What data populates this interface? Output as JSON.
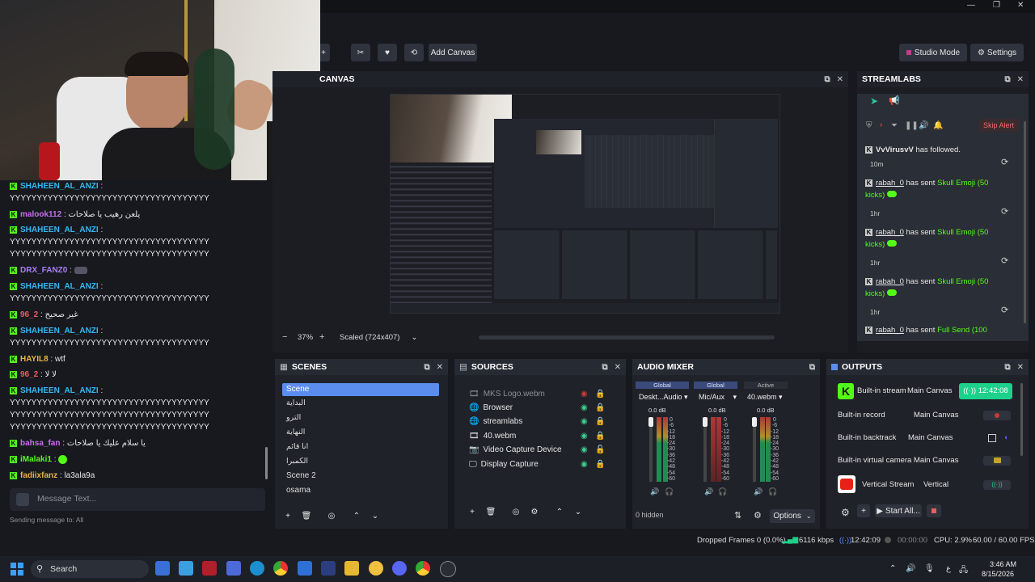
{
  "window": {
    "controls": [
      "—",
      "❐",
      "✕"
    ]
  },
  "toolbar": {
    "add_canvas_label": "Add Canvas",
    "studio_mode_label": "Studio Mode",
    "settings_label": "Settings"
  },
  "canvas": {
    "title": "CANVAS",
    "zoom": "37%",
    "scale_mode": "Scaled (724x407)",
    "minus": "−",
    "plus": "+"
  },
  "chat": {
    "messages": [
      {
        "user": "SHAHEEN_AL_ANZI",
        "color": "#35b7f3",
        "text": ":",
        "cont": "YYYYYYYYYYYYYYYYYYYYYYYYYYYYYYYYYYYYY"
      },
      {
        "user": "malook112",
        "color": "#c86ff0",
        "text": ": يلعن رهيب يا صلاحات",
        "cont": ""
      },
      {
        "user": "SHAHEEN_AL_ANZI",
        "color": "#35b7f3",
        "text": ":",
        "cont": "YYYYYYYYYYYYYYYYYYYYYYYYYYYYYYYYYYYYY",
        "cont2": "YYYYYYYYYYYYYYYYYYYYYYYYYYYYYYYYYYYYY"
      },
      {
        "user": "DRX_FANZ0",
        "color": "#a97ff5",
        "text": ":",
        "cont": ""
      },
      {
        "user": "SHAHEEN_AL_ANZI",
        "color": "#35b7f3",
        "text": ":",
        "cont": "YYYYYYYYYYYYYYYYYYYYYYYYYYYYYYYYYYYYY"
      },
      {
        "user": "96_2",
        "color": "#f05b5b",
        "text": ": غير صحيح",
        "cont": ""
      },
      {
        "user": "SHAHEEN_AL_ANZI",
        "color": "#35b7f3",
        "text": ":",
        "cont": "YYYYYYYYYYYYYYYYYYYYYYYYYYYYYYYYYYYYY"
      },
      {
        "user": "HAYIL8",
        "color": "#e7b348",
        "text": ": wtf",
        "cont": ""
      },
      {
        "user": "96_2",
        "color": "#f05b5b",
        "text": ": لا لا",
        "cont": ""
      },
      {
        "user": "SHAHEEN_AL_ANZI",
        "color": "#35b7f3",
        "text": ":",
        "cont": "YYYYYYYYYYYYYYYYYYYYYYYYYYYYYYYYYYYYY",
        "cont2": "YYYYYYYYYYYYYYYYYYYYYYYYYYYYYYYYYYYYY",
        "cont3": "YYYYYYYYYYYYYYYYYYYYYYYYYYYYYYYYYYYYY"
      },
      {
        "user": "bahsa_fan",
        "color": "#c86ff0",
        "text": ": يا سلام عليك يا صلاحات",
        "cont": ""
      },
      {
        "user": "iMalaki1",
        "color": "#53fc18",
        "text": ":",
        "cont": ""
      },
      {
        "user": "fadiixfanz",
        "color": "#e7b348",
        "text": ": la3ala9a",
        "cont": ""
      }
    ],
    "input_placeholder": "Message Text...",
    "sending_to": "Sending message to: All"
  },
  "streamlabs": {
    "title": "STREAMLABS",
    "skip_alert_label": "Skip Alert",
    "events": [
      {
        "user": "VvVirusvV",
        "action": "has followed.",
        "item": "",
        "time": "10m"
      },
      {
        "user": "rabah_0",
        "action": "has sent",
        "item": "Skull Emoji (50",
        "item2": "kicks)",
        "time": "1hr"
      },
      {
        "user": "rabah_0",
        "action": "has sent",
        "item": "Skull Emoji (50",
        "item2": "kicks)",
        "time": "1hr"
      },
      {
        "user": "rabah_0",
        "action": "has sent",
        "item": "Skull Emoji (50",
        "item2": "kicks)",
        "time": "1hr"
      },
      {
        "user": "rabah_0",
        "action": "has sent",
        "item": "Full Send (100",
        "item2": "",
        "time": ""
      }
    ]
  },
  "scenes": {
    "title": "SCENES",
    "items": [
      "Scene",
      "البداية",
      "الترو",
      "النهاية",
      "انا قائم",
      "الكمبرا",
      "Scene 2",
      "osama"
    ],
    "selected": "Scene"
  },
  "sources": {
    "title": "SOURCES",
    "items": [
      {
        "name": "MKS Logo.webm",
        "icon": "film-icon",
        "visible": false
      },
      {
        "name": "Browser",
        "icon": "globe-icon",
        "visible": true
      },
      {
        "name": "streamlabs",
        "icon": "globe-icon",
        "visible": true
      },
      {
        "name": "40.webm",
        "icon": "film-icon",
        "visible": true
      },
      {
        "name": "Video Capture Device",
        "icon": "camera-icon",
        "visible": true
      },
      {
        "name": "Display Capture",
        "icon": "monitor-icon",
        "visible": true
      }
    ]
  },
  "audio_mixer": {
    "title": "AUDIO MIXER",
    "channels": [
      {
        "group": "Global",
        "source": "Deskt...Audio",
        "db": "0.0 dB"
      },
      {
        "group": "Global",
        "source": "Mic/Aux",
        "db": "0.0 dB"
      },
      {
        "group": "Active",
        "source": "40.webm",
        "db": "0.0 dB"
      }
    ],
    "scale": [
      "0",
      "-6",
      "-12",
      "-18",
      "-24",
      "-30",
      "-36",
      "-42",
      "-48",
      "-54",
      "-60"
    ],
    "hidden_label": "0 hidden",
    "options_label": "Options"
  },
  "outputs": {
    "title": "OUTPUTS",
    "rows": [
      {
        "name": "Built-in stream",
        "canvas": "Main Canvas",
        "status": "12:42:08"
      },
      {
        "name": "Built-in record",
        "canvas": "Main Canvas",
        "status": ""
      },
      {
        "name": "Built-in backtrack",
        "canvas": "Main Canvas",
        "status": ""
      },
      {
        "name": "Built-in virtual camera",
        "canvas": "Main Canvas",
        "status": ""
      },
      {
        "name": "Vertical Stream",
        "canvas": "Vertical",
        "status": ""
      }
    ],
    "start_all_label": "Start All..."
  },
  "status_bar": {
    "dropped_frames": "Dropped Frames 0 (0.0%)",
    "bitrate": "6116 kbps",
    "stream_time": "12:42:09",
    "record_time": "00:00:00",
    "cpu": "CPU: 2.9%",
    "fps": "60.00 / 60.00 FPS"
  },
  "taskbar": {
    "search_label": "Search",
    "time": "3:46 AM",
    "date": "8/15/2026",
    "lang": "ع"
  },
  "colors": {
    "kick_green": "#53fc18",
    "stream_live": "#1ed18a",
    "accent_blue": "#5b8def"
  }
}
